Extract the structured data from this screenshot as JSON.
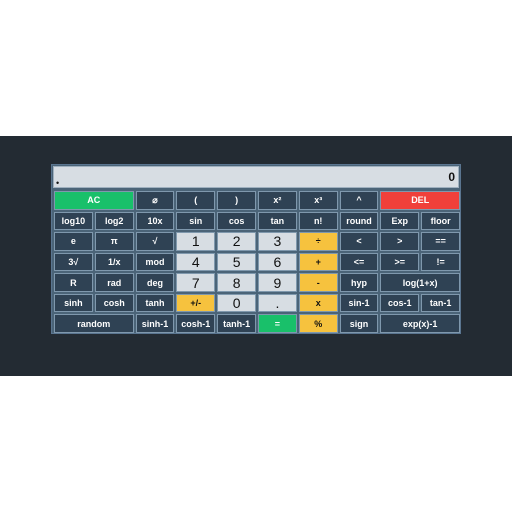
{
  "display": {
    "value": "0",
    "expression": "•"
  },
  "rows": [
    [
      {
        "id": "ac",
        "label": "AC",
        "type": "green",
        "span": 2
      },
      {
        "id": "empty-set",
        "label": "⌀"
      },
      {
        "id": "open-paren",
        "label": "("
      },
      {
        "id": "close-paren",
        "label": ")"
      },
      {
        "id": "square",
        "label": "x²"
      },
      {
        "id": "cube",
        "label": "x³"
      },
      {
        "id": "power",
        "label": "^"
      },
      {
        "id": "del",
        "label": "DEL",
        "type": "red",
        "span": 2
      }
    ],
    [
      {
        "id": "log10",
        "label": "log10"
      },
      {
        "id": "log2",
        "label": "log2"
      },
      {
        "id": "ten-power",
        "label": "10x"
      },
      {
        "id": "sin",
        "label": "sin"
      },
      {
        "id": "cos",
        "label": "cos"
      },
      {
        "id": "tan",
        "label": "tan"
      },
      {
        "id": "factorial",
        "label": "n!"
      },
      {
        "id": "round",
        "label": "round"
      },
      {
        "id": "exp",
        "label": "Exp"
      },
      {
        "id": "floor",
        "label": "floor"
      }
    ],
    [
      {
        "id": "e",
        "label": "e"
      },
      {
        "id": "pi",
        "label": "π"
      },
      {
        "id": "sqrt",
        "label": "√"
      },
      {
        "id": "digit-1",
        "label": "1",
        "type": "num"
      },
      {
        "id": "digit-2",
        "label": "2",
        "type": "num"
      },
      {
        "id": "digit-3",
        "label": "3",
        "type": "num"
      },
      {
        "id": "divide",
        "label": "÷",
        "type": "op"
      },
      {
        "id": "less-than",
        "label": "<"
      },
      {
        "id": "greater-than",
        "label": ">"
      },
      {
        "id": "equals-compare",
        "label": "=="
      }
    ],
    [
      {
        "id": "cube-root",
        "label": "3√"
      },
      {
        "id": "reciprocal",
        "label": "1/x"
      },
      {
        "id": "mod",
        "label": "mod"
      },
      {
        "id": "digit-4",
        "label": "4",
        "type": "num"
      },
      {
        "id": "digit-5",
        "label": "5",
        "type": "num"
      },
      {
        "id": "digit-6",
        "label": "6",
        "type": "num"
      },
      {
        "id": "plus",
        "label": "+",
        "type": "op"
      },
      {
        "id": "less-equal",
        "label": "<="
      },
      {
        "id": "greater-equal",
        "label": ">="
      },
      {
        "id": "not-equal",
        "label": "!="
      }
    ],
    [
      {
        "id": "r",
        "label": "R"
      },
      {
        "id": "rad",
        "label": "rad"
      },
      {
        "id": "deg",
        "label": "deg"
      },
      {
        "id": "digit-7",
        "label": "7",
        "type": "num"
      },
      {
        "id": "digit-8",
        "label": "8",
        "type": "num"
      },
      {
        "id": "digit-9",
        "label": "9",
        "type": "num"
      },
      {
        "id": "minus",
        "label": "-",
        "type": "op"
      },
      {
        "id": "hyp",
        "label": "hyp"
      },
      {
        "id": "log1p",
        "label": "log(1+x)",
        "span": 2
      }
    ],
    [
      {
        "id": "sinh",
        "label": "sinh"
      },
      {
        "id": "cosh",
        "label": "cosh"
      },
      {
        "id": "tanh",
        "label": "tanh"
      },
      {
        "id": "negate",
        "label": "+/-",
        "type": "op"
      },
      {
        "id": "digit-0",
        "label": "0",
        "type": "num"
      },
      {
        "id": "decimal",
        "label": ".",
        "type": "num"
      },
      {
        "id": "multiply",
        "label": "x",
        "type": "op"
      },
      {
        "id": "asin",
        "label": "sin-1"
      },
      {
        "id": "acos",
        "label": "cos-1"
      },
      {
        "id": "atan",
        "label": "tan-1"
      }
    ],
    [
      {
        "id": "random",
        "label": "random",
        "span": 2
      },
      {
        "id": "asinh",
        "label": "sinh-1"
      },
      {
        "id": "acosh",
        "label": "cosh-1"
      },
      {
        "id": "atanh",
        "label": "tanh-1"
      },
      {
        "id": "equals",
        "label": "=",
        "type": "green"
      },
      {
        "id": "percent",
        "label": "%",
        "type": "op"
      },
      {
        "id": "sign",
        "label": "sign"
      },
      {
        "id": "expm1",
        "label": "exp(x)-1",
        "span": 2
      }
    ]
  ]
}
